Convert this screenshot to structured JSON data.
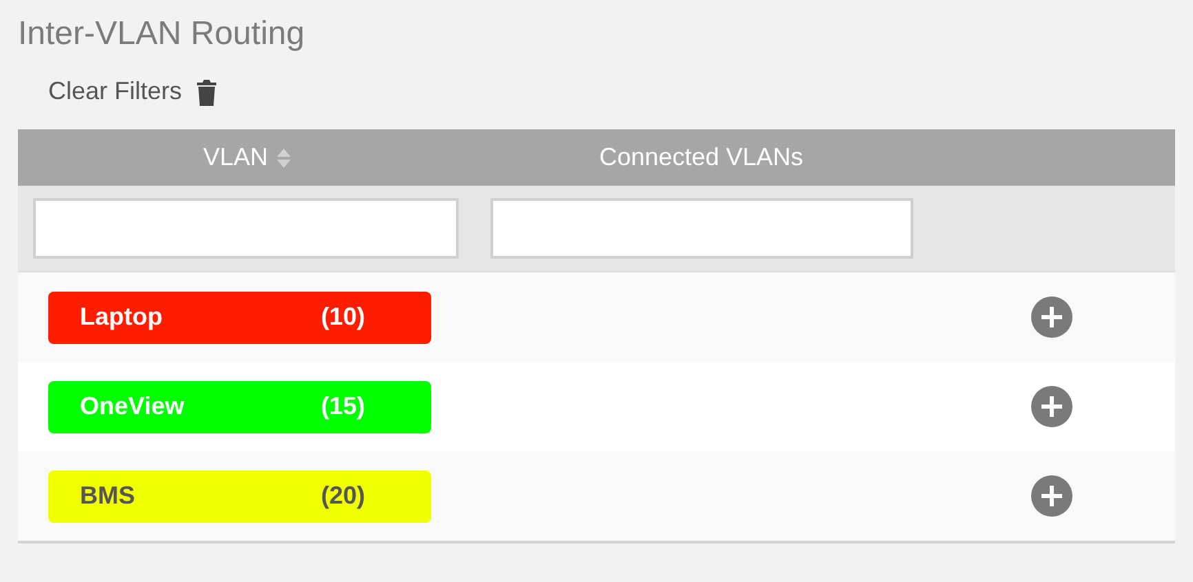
{
  "title": "Inter-VLAN Routing",
  "clear_filters": {
    "label": "Clear Filters"
  },
  "table": {
    "columns": [
      {
        "label": "VLAN",
        "sortable": true
      },
      {
        "label": "Connected VLANs",
        "sortable": false
      }
    ],
    "rows": [
      {
        "name": "Laptop",
        "count": "(10)",
        "color": "#ff1d00"
      },
      {
        "name": "OneView",
        "count": "(15)",
        "color": "#00ff00"
      },
      {
        "name": "BMS",
        "count": "(20)",
        "color": "#f0ff00"
      }
    ]
  }
}
